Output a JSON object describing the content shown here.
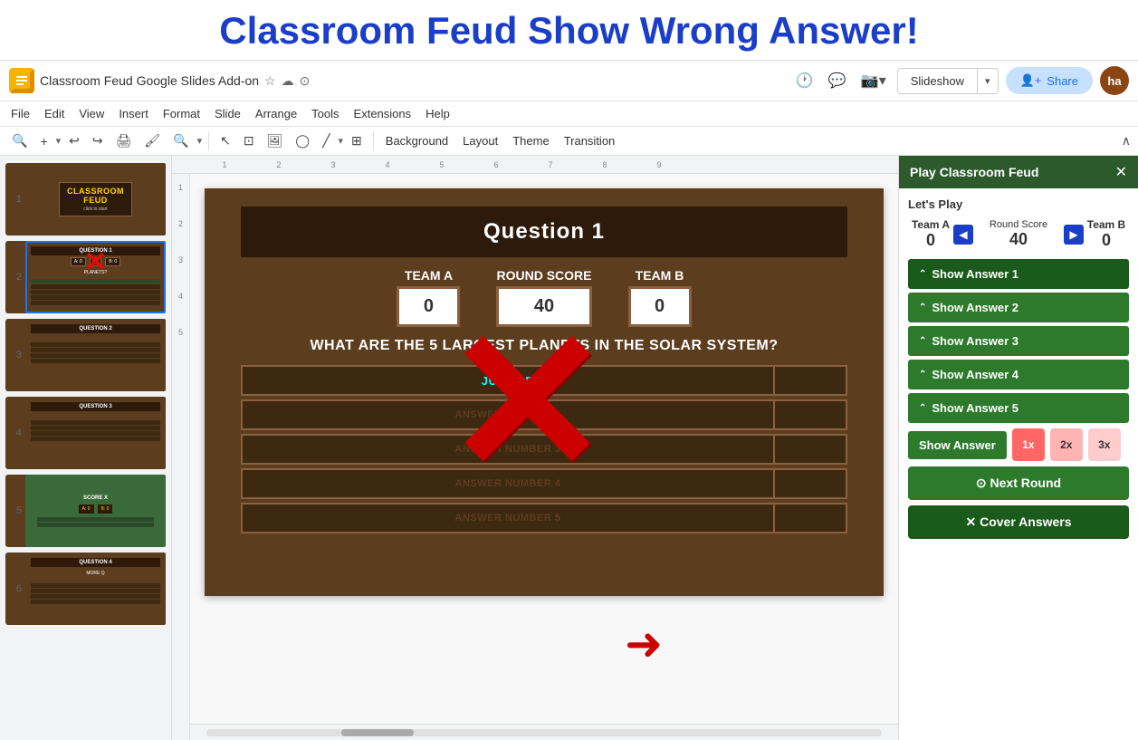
{
  "title": "Classroom Feud Show Wrong Answer!",
  "app": {
    "doc_title": "Classroom Feud Google Slides Add-on",
    "avatar": "ha"
  },
  "menu": {
    "file": "File",
    "edit": "Edit",
    "view": "View",
    "insert": "Insert",
    "format": "Format",
    "slide": "Slide",
    "arrange": "Arrange",
    "tools": "Tools",
    "extensions": "Extensions",
    "help": "Help"
  },
  "toolbar": {
    "background": "Background",
    "layout": "Layout",
    "theme": "Theme",
    "transition": "Transition",
    "slideshow": "Slideshow",
    "share": "Share"
  },
  "slide_panel": {
    "slides": [
      {
        "num": "1",
        "type": "title"
      },
      {
        "num": "2",
        "type": "question",
        "active": true
      },
      {
        "num": "3",
        "type": "question"
      },
      {
        "num": "4",
        "type": "question"
      },
      {
        "num": "5",
        "type": "results"
      },
      {
        "num": "6",
        "type": "question2"
      }
    ]
  },
  "main_slide": {
    "question_title": "Question 1",
    "team_a_label": "TEAM A",
    "round_score_label": "ROUND SCORE",
    "team_b_label": "TEAM B",
    "team_a_score": "0",
    "round_score": "40",
    "team_b_score": "0",
    "question_text": "What Are The 5 Largest Planets In The Solar System?",
    "answers": [
      {
        "label": "Jupiter",
        "score": "",
        "revealed": true
      },
      {
        "label": "Answer Number 2",
        "score": "",
        "revealed": false
      },
      {
        "label": "Answer Number 3",
        "score": "",
        "revealed": false
      },
      {
        "label": "Answer Number 4",
        "score": "",
        "revealed": false
      },
      {
        "label": "Answer Number 5",
        "score": "",
        "revealed": false
      }
    ]
  },
  "right_panel": {
    "title": "Play Classroom Feud",
    "lets_play": "Let's Play",
    "team_a_label": "Team A",
    "team_a_score": "0",
    "round_score_label": "Round Score",
    "round_score": "40",
    "team_b_label": "Team B",
    "team_b_score": "0",
    "answer_buttons": [
      {
        "label": "Show Answer 1",
        "id": "ans1"
      },
      {
        "label": "Show Answer 2",
        "id": "ans2"
      },
      {
        "label": "Show Answer 3",
        "id": "ans3"
      },
      {
        "label": "Show Answer 4",
        "id": "ans4"
      },
      {
        "label": "Show Answer 5",
        "id": "ans5"
      }
    ],
    "show_answer_label": "Show Answer",
    "multipliers": [
      "1x",
      "2x",
      "3x"
    ],
    "next_round_label": "⊙ Next Round",
    "cover_answers_label": "✕ Cover Answers"
  }
}
